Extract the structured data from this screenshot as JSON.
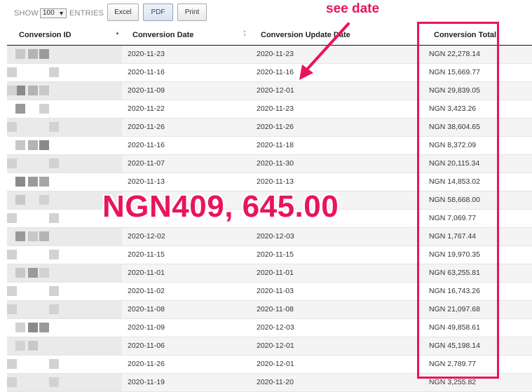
{
  "toolbar": {
    "show_label": "SHOW",
    "entries_value": "100",
    "entries_label": "ENTRIES",
    "excel_label": "Excel",
    "pdf_label": "PDF",
    "print_label": "Print"
  },
  "table": {
    "headers": {
      "id": "Conversion ID",
      "date": "Conversion Date",
      "update": "Conversion Update Date",
      "total": "Conversion Total"
    },
    "rows": [
      {
        "date": "2020-11-23",
        "update": "2020-11-23",
        "total": "NGN 22,278.14"
      },
      {
        "date": "2020-11-16",
        "update": "2020-11-16",
        "total": "NGN 15,669.77"
      },
      {
        "date": "2020-11-09",
        "update": "2020-12-01",
        "total": "NGN 29,839.05"
      },
      {
        "date": "2020-11-22",
        "update": "2020-11-23",
        "total": "NGN 3,423.26"
      },
      {
        "date": "2020-11-26",
        "update": "2020-11-26",
        "total": "NGN 38,604.65"
      },
      {
        "date": "2020-11-16",
        "update": "2020-11-18",
        "total": "NGN 8,372.09"
      },
      {
        "date": "2020-11-07",
        "update": "2020-11-30",
        "total": "NGN 20,115.34"
      },
      {
        "date": "2020-11-13",
        "update": "2020-11-13",
        "total": "NGN 14,853.02"
      },
      {
        "date": "",
        "update": "",
        "total": "NGN 58,668.00"
      },
      {
        "date": "",
        "update": "",
        "total": "NGN 7,069.77"
      },
      {
        "date": "2020-12-02",
        "update": "2020-12-03",
        "total": "NGN 1,767.44"
      },
      {
        "date": "2020-11-15",
        "update": "2020-11-15",
        "total": "NGN 19,970.35"
      },
      {
        "date": "2020-11-01",
        "update": "2020-11-01",
        "total": "NGN 63,255.81"
      },
      {
        "date": "2020-11-02",
        "update": "2020-11-03",
        "total": "NGN 16,743.26"
      },
      {
        "date": "2020-11-08",
        "update": "2020-11-08",
        "total": "NGN 21,097.68"
      },
      {
        "date": "2020-11-09",
        "update": "2020-12-03",
        "total": "NGN 49,858.61"
      },
      {
        "date": "2020-11-06",
        "update": "2020-12-01",
        "total": "NGN 45,198.14"
      },
      {
        "date": "2020-11-26",
        "update": "2020-12-01",
        "total": "NGN 2,789.77"
      },
      {
        "date": "2020-11-19",
        "update": "2020-11-20",
        "total": "NGN 3,255.82"
      }
    ]
  },
  "annotations": {
    "see_date": "see date",
    "big_total": "NGN409, 645.00",
    "accent_color": "#e8145e"
  }
}
